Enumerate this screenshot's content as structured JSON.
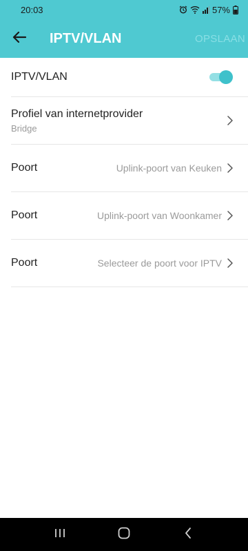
{
  "status_bar": {
    "time": "20:03",
    "battery": "57%"
  },
  "app_bar": {
    "title": "IPTV/VLAN",
    "save_label": "OPSLAAN"
  },
  "settings": {
    "iptv_toggle": {
      "label": "IPTV/VLAN",
      "enabled": true
    },
    "isp_profile": {
      "label": "Profiel van internetprovider",
      "value": "Bridge"
    },
    "ports": [
      {
        "label": "Poort",
        "value": "Uplink-poort van Keuken"
      },
      {
        "label": "Poort",
        "value": "Uplink-poort van Woonkamer"
      },
      {
        "label": "Poort",
        "value": "Selecteer de poort voor IPTV"
      }
    ]
  },
  "colors": {
    "accent": "#4fc9d1",
    "toggle_on": "#3fc1cb"
  }
}
